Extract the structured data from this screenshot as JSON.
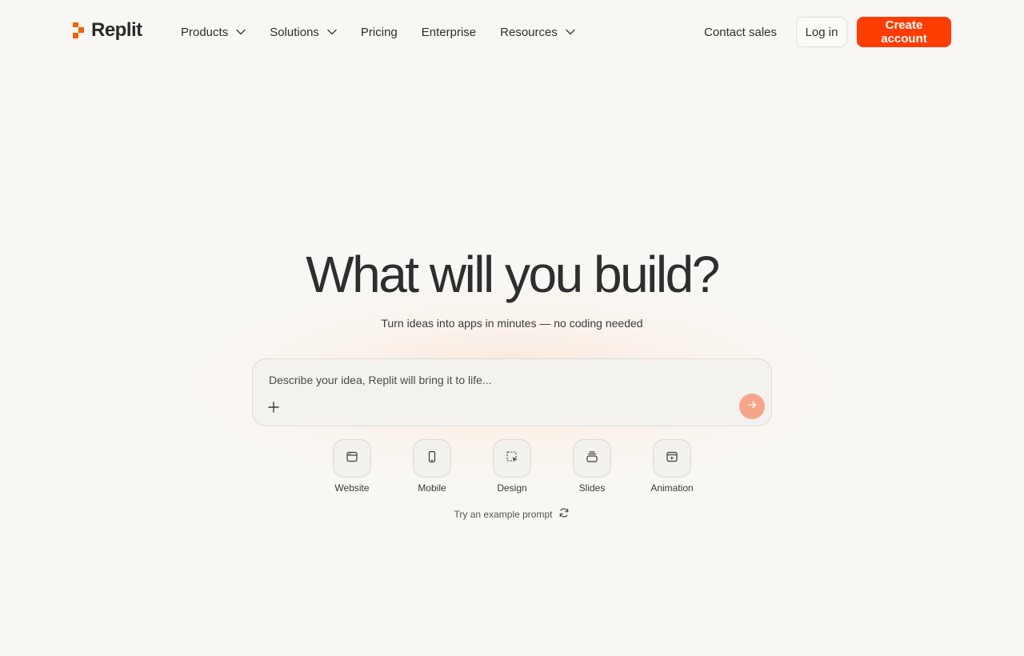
{
  "brand": {
    "name": "Replit",
    "accent": "#ff3c00"
  },
  "nav": {
    "items": [
      {
        "label": "Products",
        "has_dropdown": true
      },
      {
        "label": "Solutions",
        "has_dropdown": true
      },
      {
        "label": "Pricing",
        "has_dropdown": false
      },
      {
        "label": "Enterprise",
        "has_dropdown": false
      },
      {
        "label": "Resources",
        "has_dropdown": true
      }
    ],
    "contact_label": "Contact sales",
    "login_label": "Log in",
    "create_label": "Create account"
  },
  "hero": {
    "title": "What will you build?",
    "subtitle": "Turn ideas into apps in minutes — no coding needed"
  },
  "prompt": {
    "placeholder": "Describe your idea, Replit will bring it to life...",
    "value": "",
    "attach_icon": "plus-icon",
    "send_icon": "arrow-right-icon",
    "send_color": "#f6a58a"
  },
  "types": [
    {
      "label": "Website",
      "icon": "browser-window-icon"
    },
    {
      "label": "Mobile",
      "icon": "phone-icon"
    },
    {
      "label": "Design",
      "icon": "dashed-select-cursor-icon"
    },
    {
      "label": "Slides",
      "icon": "stacked-slides-icon"
    },
    {
      "label": "Animation",
      "icon": "video-play-icon"
    }
  ],
  "example": {
    "label": "Try an example prompt",
    "icon": "refresh-icon"
  }
}
